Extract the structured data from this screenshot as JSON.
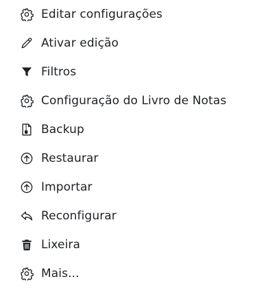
{
  "menu": {
    "items": [
      {
        "label": "Editar configurações",
        "icon": "gear-icon"
      },
      {
        "label": "Ativar edição",
        "icon": "pencil-icon"
      },
      {
        "label": "Filtros",
        "icon": "filter-icon"
      },
      {
        "label": "Configuração do Livro de Notas",
        "icon": "gear-icon"
      },
      {
        "label": "Backup",
        "icon": "file-archive-icon"
      },
      {
        "label": "Restaurar",
        "icon": "circle-arrow-up-icon"
      },
      {
        "label": "Importar",
        "icon": "circle-arrow-up-icon"
      },
      {
        "label": "Reconfigurar",
        "icon": "reply-icon"
      },
      {
        "label": "Lixeira",
        "icon": "trash-icon"
      },
      {
        "label": "Mais...",
        "icon": "gear-icon"
      }
    ]
  },
  "colors": {
    "text": "#1d2125",
    "background": "#ffffff"
  }
}
